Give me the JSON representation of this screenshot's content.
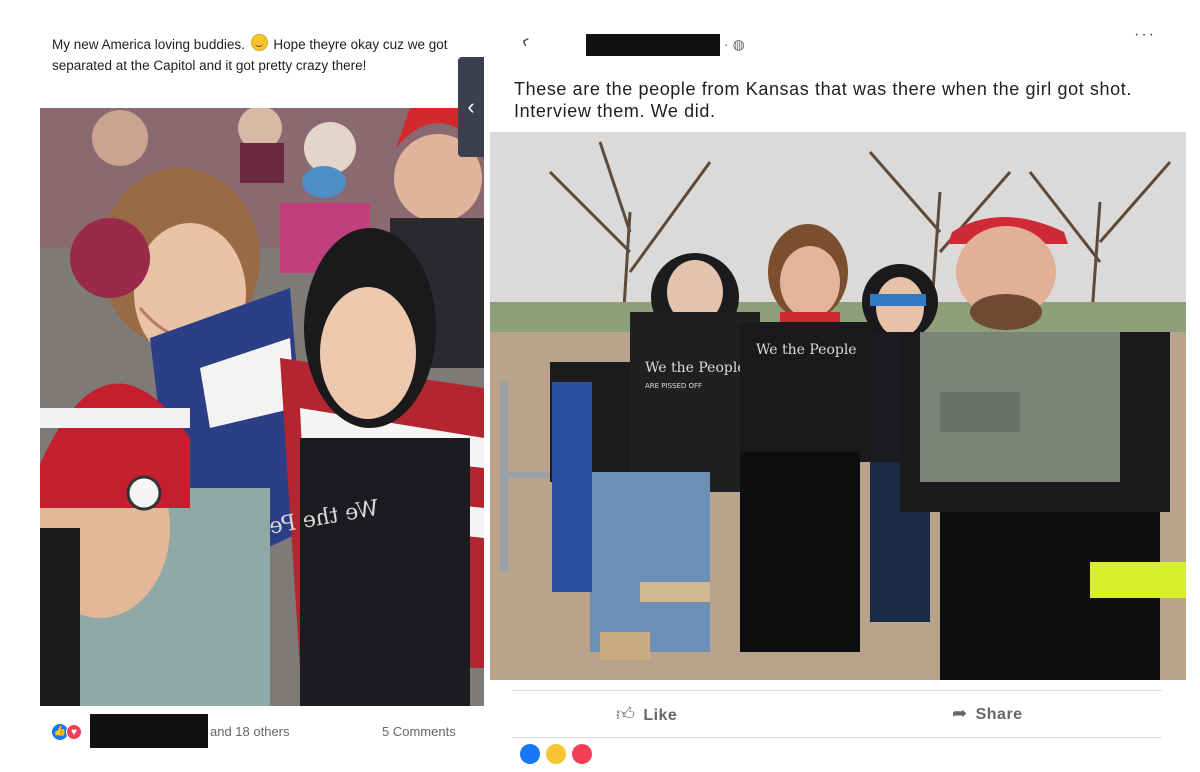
{
  "left_post": {
    "caption_part1": "My new America loving buddies.",
    "caption_part2": "Hope theyre okay cuz we got separated at the Capitol and it got pretty crazy there!",
    "nav_tab_glyph": "‹",
    "reactions": {
      "like_icon": "thumbs-up-icon",
      "love_icon": "heart-icon",
      "others_text": "and 18 others",
      "comments_text": "5 Comments"
    }
  },
  "right_post": {
    "header_dot": "·",
    "more_glyph": "···",
    "caption": "These are the people from Kansas that was there when the girl got shot. Interview them. We did.",
    "shirt_text": "We the People",
    "shirt_subtext": "ARE PISSED OFF",
    "actions": {
      "like_label": "Like",
      "share_label": "Share"
    }
  },
  "colors": {
    "facebook_blue": "#1877f2",
    "love_red": "#f33e58",
    "maga_red": "#c8102e",
    "redaction_black": "#111111"
  }
}
